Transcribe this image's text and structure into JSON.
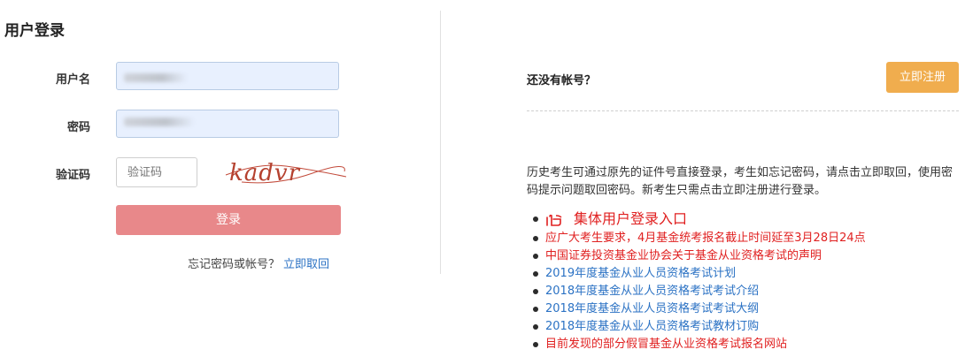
{
  "login": {
    "title": "用户登录",
    "username_label": "用户名",
    "password_label": "密码",
    "captcha_label": "验证码",
    "captcha_placeholder": "验证码",
    "captcha_text": "kadvr",
    "login_button": "登录",
    "forgot_text": "忘记密码或帐号？",
    "forgot_link": "立即取回"
  },
  "register": {
    "no_account_text": "还没有帐号？",
    "register_button": "立即注册",
    "description": "历史考生可通过原先的证件号直接登录，考生如忘记密码，请点击立即取回，使用密码提示问题取回密码。新考生只需点击立即注册进行登录。"
  },
  "news": [
    {
      "text": "集体用户登录入口",
      "color": "#e02020",
      "icon": "pointing-hand-icon"
    },
    {
      "text": "应广大考生要求，4月基金统考报名截止时间延至3月28日24点",
      "color": "#e02020"
    },
    {
      "text": "中国证券投资基金业协会关于基金从业资格考试的声明",
      "color": "#e02020"
    },
    {
      "text": "2019年度基金从业人员资格考试计划",
      "color": "#2b72c4"
    },
    {
      "text": "2018年度基金从业人员资格考试考试介绍",
      "color": "#2b72c4"
    },
    {
      "text": "2018年度基金从业人员资格考试考试大纲",
      "color": "#2b72c4"
    },
    {
      "text": "2018年度基金从业人员资格考试教材订购",
      "color": "#2b72c4"
    },
    {
      "text": "目前发现的部分假冒基金从业资格考试报名网站",
      "color": "#e02020"
    }
  ]
}
